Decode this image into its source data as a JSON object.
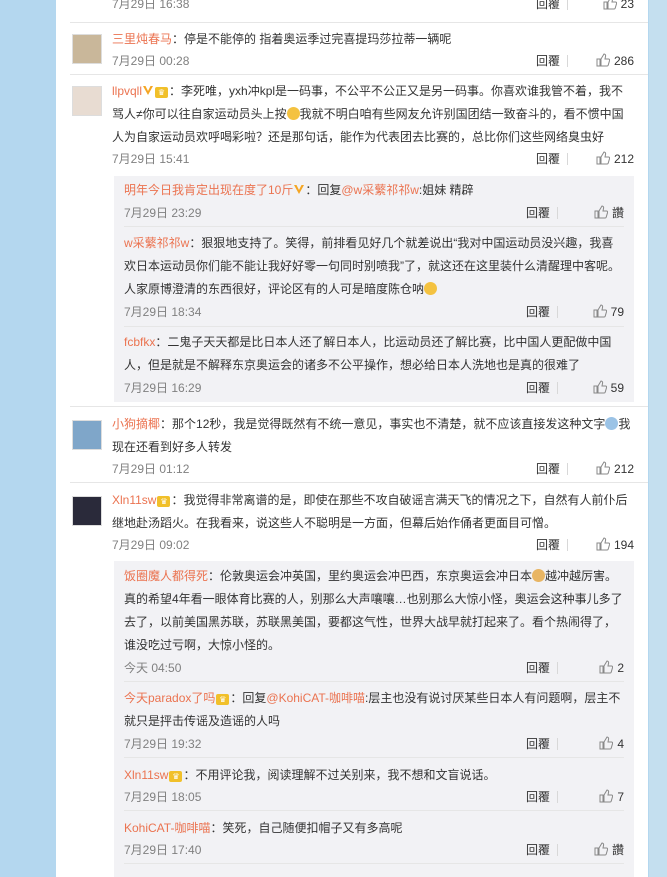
{
  "colors": {
    "name": "#eb7350",
    "meta": "#808080",
    "background": "#b4d7ef",
    "subPanel": "#f2f2f5"
  },
  "comments": [
    {
      "id": "top",
      "time": "7月29日 16:38",
      "reply": "回覆",
      "likes": "23"
    },
    {
      "id": "c1",
      "user": "三里炖春马",
      "text": "：停是不能停的 指着奥运季过完喜提玛莎拉蒂一辆呢",
      "time": "7月29日 00:28",
      "reply": "回覆",
      "likes": "286",
      "avatar_color": "#c9b79a"
    },
    {
      "id": "c2",
      "user": "llpvqll",
      "text_a": "：李死唯，yxh冲kpl是一码事，不公平不公正又是另一码事。你喜欢谁我管不着，我不骂人≠你可以往自家运动员头上按",
      "text_b": "我就不明白咱有些网友允许别国团结一致奋斗的，看不惯中国人为自家运动员欢呼喝彩啦？还是那句话，能作为代表团去比赛的，总比你们这些网络臭虫好",
      "time": "7月29日 15:41",
      "reply": "回覆",
      "likes": "212",
      "avatar_color": "#e8dcd2",
      "replies": [
        {
          "user": "明年今日我肯定出现在度了10斤",
          "text_prefix": "：回复",
          "mention": "@w采蘩祁祁w",
          "text": ":姐妹 精辟",
          "time": "7月29日 23:29",
          "reply": "回覆",
          "likes": "讚"
        },
        {
          "user": "w采蘩祁祁w",
          "text": "：狠狠地支持了。笑得，前排看见好几个就差说出“我对中国运动员没兴趣，我喜欢日本运动员你们能不能让我好好零一句同时别喷我”了，就这还在这里装什么清醒理中客呢。人家原博澄清的东西很好，评论区有的人可是暗度陈仓呐",
          "time": "7月29日 18:34",
          "reply": "回覆",
          "likes": "79"
        },
        {
          "user": "fcbfkx",
          "text": "：二鬼子天天都是比日本人还了解日本人，比运动员还了解比赛，比中国人更配做中国人，但是就是不解释东京奥运会的诸多不公平操作，想必给日本人洗地也是真的很难了",
          "time": "7月29日 16:29",
          "reply": "回覆",
          "likes": "59"
        }
      ]
    },
    {
      "id": "c3",
      "user": "小狗摘椰",
      "text": "：那个12秒，我是觉得既然有不统一意见，事实也不清楚，就不应该直接发这种文字",
      "text_b": "我现在还看到好多人转发",
      "time": "7月29日 01:12",
      "reply": "回覆",
      "likes": "212",
      "avatar_color": "#7fa6c9"
    },
    {
      "id": "c4",
      "user": "Xln11sw",
      "text": "：我觉得非常离谱的是，即使在那些不攻自破谣言满天飞的情况之下，自然有人前仆后继地赴汤蹈火。在我看来，说这些人不聪明是一方面，但幕后始作俑者更面目可憎。",
      "time": "7月29日 09:02",
      "reply": "回覆",
      "likes": "194",
      "avatar_color": "#2a2a3a",
      "replies": [
        {
          "user": "饭圈魔人都得死",
          "text": "：伦敦奥运会冲英国，里约奥运会冲巴西，东京奥运会冲日本",
          "text_b": "越冲越厉害。真的希望4年看一眼体育比赛的人，别那么大声嚷嚷…也别那么大惊小怪，奥运会这种事儿多了去了，以前美国黑苏联，苏联黑美国，要都这气性，世界大战早就打起来了。看个热闹得了，谁没吃过亏啊，大惊小怪的。",
          "time": "今天 04:50",
          "reply": "回覆",
          "likes": "2"
        },
        {
          "user": "今天paradox了吗",
          "text_prefix": "：回复",
          "mention": "@KohiCAT-咖啡喵",
          "text": ":层主也没有说讨厌某些日本人有问题啊，层主不就只是抨击传谣及造谣的人吗",
          "time": "7月29日 19:32",
          "reply": "回覆",
          "likes": "4"
        },
        {
          "user": "Xln11sw",
          "text": "：不用评论我，阅读理解不过关别来，我不想和文盲说话。",
          "time": "7月29日 18:05",
          "reply": "回覆",
          "likes": "7"
        },
        {
          "user": "KohiCAT-咖啡喵",
          "text": "：笑死，自己随便扣帽子又有多高呢",
          "time": "7月29日 17:40",
          "reply": "回覆",
          "likes": "讚"
        }
      ]
    }
  ]
}
